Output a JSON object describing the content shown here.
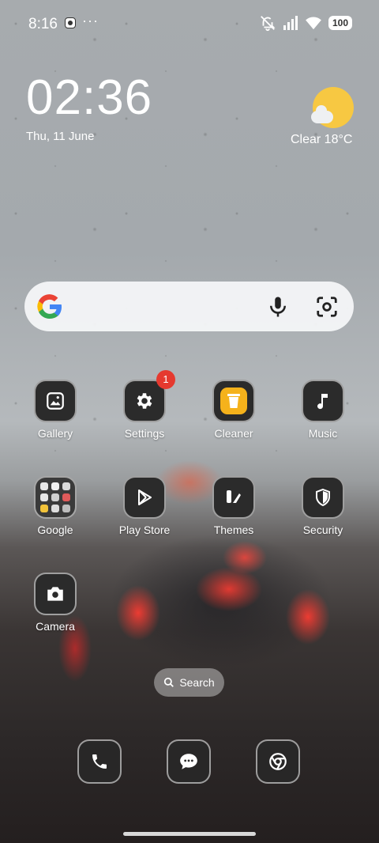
{
  "status_bar": {
    "time": "8:16",
    "more_indicator": "···",
    "battery": "100",
    "icons": [
      "app-notification-icon",
      "silent-bell-icon",
      "signal-icon",
      "wifi-icon",
      "battery-icon"
    ]
  },
  "clock_widget": {
    "time": "02:36",
    "date": "Thu, 11 June"
  },
  "weather_widget": {
    "condition": "Clear",
    "temperature": "18°C",
    "text": "Clear  18°C",
    "icon": "partly-sunny-icon"
  },
  "search_widget": {
    "logo": "google-g-icon",
    "voice": "mic-icon",
    "lens": "lens-icon"
  },
  "apps": {
    "gallery": {
      "label": "Gallery",
      "icon": "gallery-icon"
    },
    "settings": {
      "label": "Settings",
      "icon": "gear-icon",
      "badge": "1"
    },
    "cleaner": {
      "label": "Cleaner",
      "icon": "trash-icon",
      "accent": "#f5b21b"
    },
    "music": {
      "label": "Music",
      "icon": "music-note-icon"
    },
    "google": {
      "label": "Google",
      "icon": "folder-icon"
    },
    "play_store": {
      "label": "Play Store",
      "icon": "play-store-icon"
    },
    "themes": {
      "label": "Themes",
      "icon": "themes-icon"
    },
    "security": {
      "label": "Security",
      "icon": "shield-icon"
    },
    "camera": {
      "label": "Camera",
      "icon": "camera-icon"
    }
  },
  "home_search": {
    "label": "Search",
    "icon": "search-icon"
  },
  "dock": [
    {
      "name": "Phone",
      "icon": "phone-icon"
    },
    {
      "name": "Messages",
      "icon": "message-icon"
    },
    {
      "name": "Chrome",
      "icon": "chrome-icon"
    }
  ],
  "colors": {
    "badge": "#e5392f",
    "sun": "#f7c842",
    "cleaner": "#f5b21b"
  }
}
